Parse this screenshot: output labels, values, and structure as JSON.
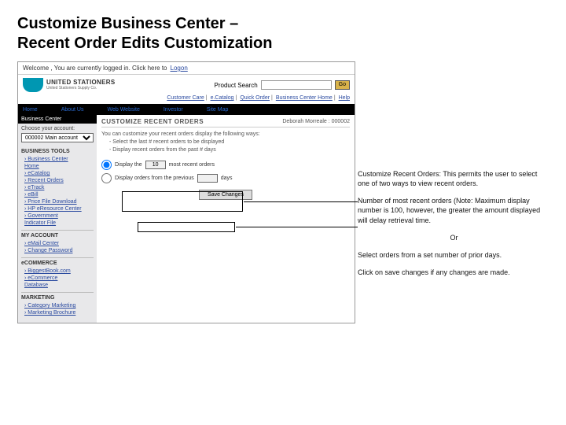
{
  "slide": {
    "title_line1": "Customize Business Center –",
    "title_line2": "Recent Order Edits Customization"
  },
  "welcome": {
    "text_prefix": "Welcome , You are currently logged in. Click here to ",
    "logon": "Logon"
  },
  "logo": {
    "name": "UNITED STATIONERS",
    "sub": "United Stationers Supply Co."
  },
  "search": {
    "label": "Product Search",
    "go": "Go"
  },
  "util": {
    "items": [
      "Customer Care",
      "e.Catalog",
      "Quick Order",
      "Business Center Home",
      "Help"
    ],
    "sep": "|"
  },
  "nav": {
    "items": [
      "Home",
      "About Us",
      "Web Website",
      "Investor",
      "Site Map"
    ]
  },
  "sidebar": {
    "panel_title": "Business Center",
    "choose_label": "Choose your account:",
    "account_value": "000002 Main account",
    "sections": {
      "tools": {
        "title": "BUSINESS TOOLS",
        "items": [
          "Business Center",
          "Home",
          "eCatalog",
          "Recent Orders",
          "eTrack",
          "eBill",
          "Price File Download",
          "HP eResource Center",
          "Government",
          "Indicator File"
        ]
      },
      "account": {
        "title": "MY ACCOUNT",
        "items": [
          "eMail Center",
          "Change Password"
        ]
      },
      "ecom": {
        "title": "eCOMMERCE",
        "items": [
          "BiggestBook.com",
          "eCommerce",
          "Database"
        ]
      },
      "marketing": {
        "title": "MARKETING",
        "items": [
          "Category Marketing",
          "Marketing Brochure"
        ]
      }
    }
  },
  "main": {
    "title": "CUSTOMIZE RECENT ORDERS",
    "user": "Deborah Morreale : 000002",
    "intro": "You can customize your recent orders display the following ways:",
    "intro_a": "- Select the last # recent orders to be displayed",
    "intro_b": "- Display recent orders from the past # days",
    "opt1_a": "Display the",
    "opt1_val": "10",
    "opt1_b": "most recent orders",
    "opt2_a": "Display orders from the previous",
    "opt2_val": "",
    "opt2_b": "days",
    "save": "Save Changes"
  },
  "callouts": {
    "p1": "Customize Recent Orders:  This permits the user to select one of two ways to view recent orders.",
    "p2": "Number of most recent orders  (Note: Maximum display number is 100, however, the greater the amount displayed will delay retrieval time.",
    "or": "Or",
    "p3": "Select orders from a set number of prior days.",
    "p4": "Click on save changes if any changes are made."
  }
}
